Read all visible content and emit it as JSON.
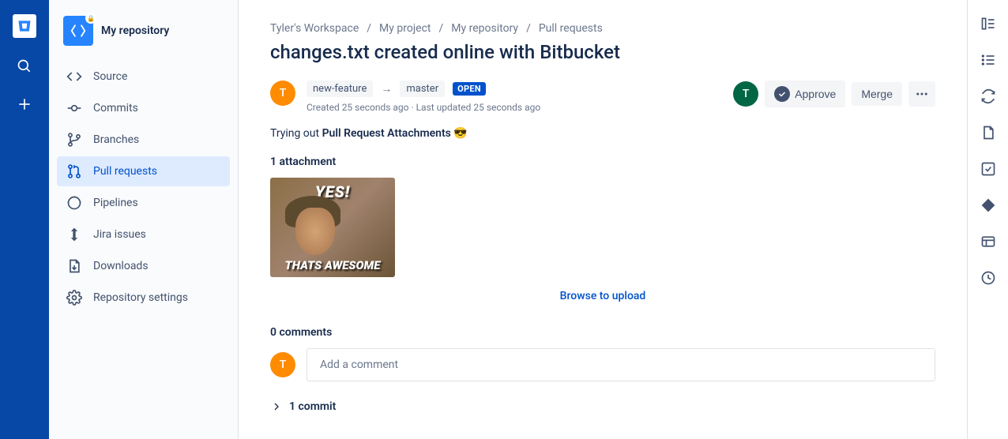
{
  "sidebar": {
    "title": "My repository",
    "items": [
      {
        "label": "Source"
      },
      {
        "label": "Commits"
      },
      {
        "label": "Branches"
      },
      {
        "label": "Pull requests"
      },
      {
        "label": "Pipelines"
      },
      {
        "label": "Jira issues"
      },
      {
        "label": "Downloads"
      },
      {
        "label": "Repository settings"
      }
    ]
  },
  "breadcrumb": {
    "items": [
      "Tyler's Workspace",
      "My project",
      "My repository",
      "Pull requests"
    ]
  },
  "page_title": "changes.txt created online with Bitbucket",
  "author": {
    "initial": "T"
  },
  "reviewer": {
    "initial": "T"
  },
  "commenter": {
    "initial": "T"
  },
  "branches": {
    "source": "new-feature",
    "target": "master"
  },
  "status": "OPEN",
  "timestamps": "Created 25 seconds ago · Last updated 25 seconds ago",
  "actions": {
    "approve": "Approve",
    "merge": "Merge"
  },
  "description": {
    "prefix": "Trying out ",
    "bold": "Pull Request Attachments ",
    "emoji": "😎"
  },
  "attachments": {
    "title": "1 attachment",
    "thumb_top": "YES!",
    "thumb_bottom": "THATS AWESOME",
    "browse": "Browse to upload"
  },
  "comments": {
    "title": "0 comments",
    "placeholder": "Add a comment"
  },
  "commits": {
    "title": "1 commit"
  }
}
